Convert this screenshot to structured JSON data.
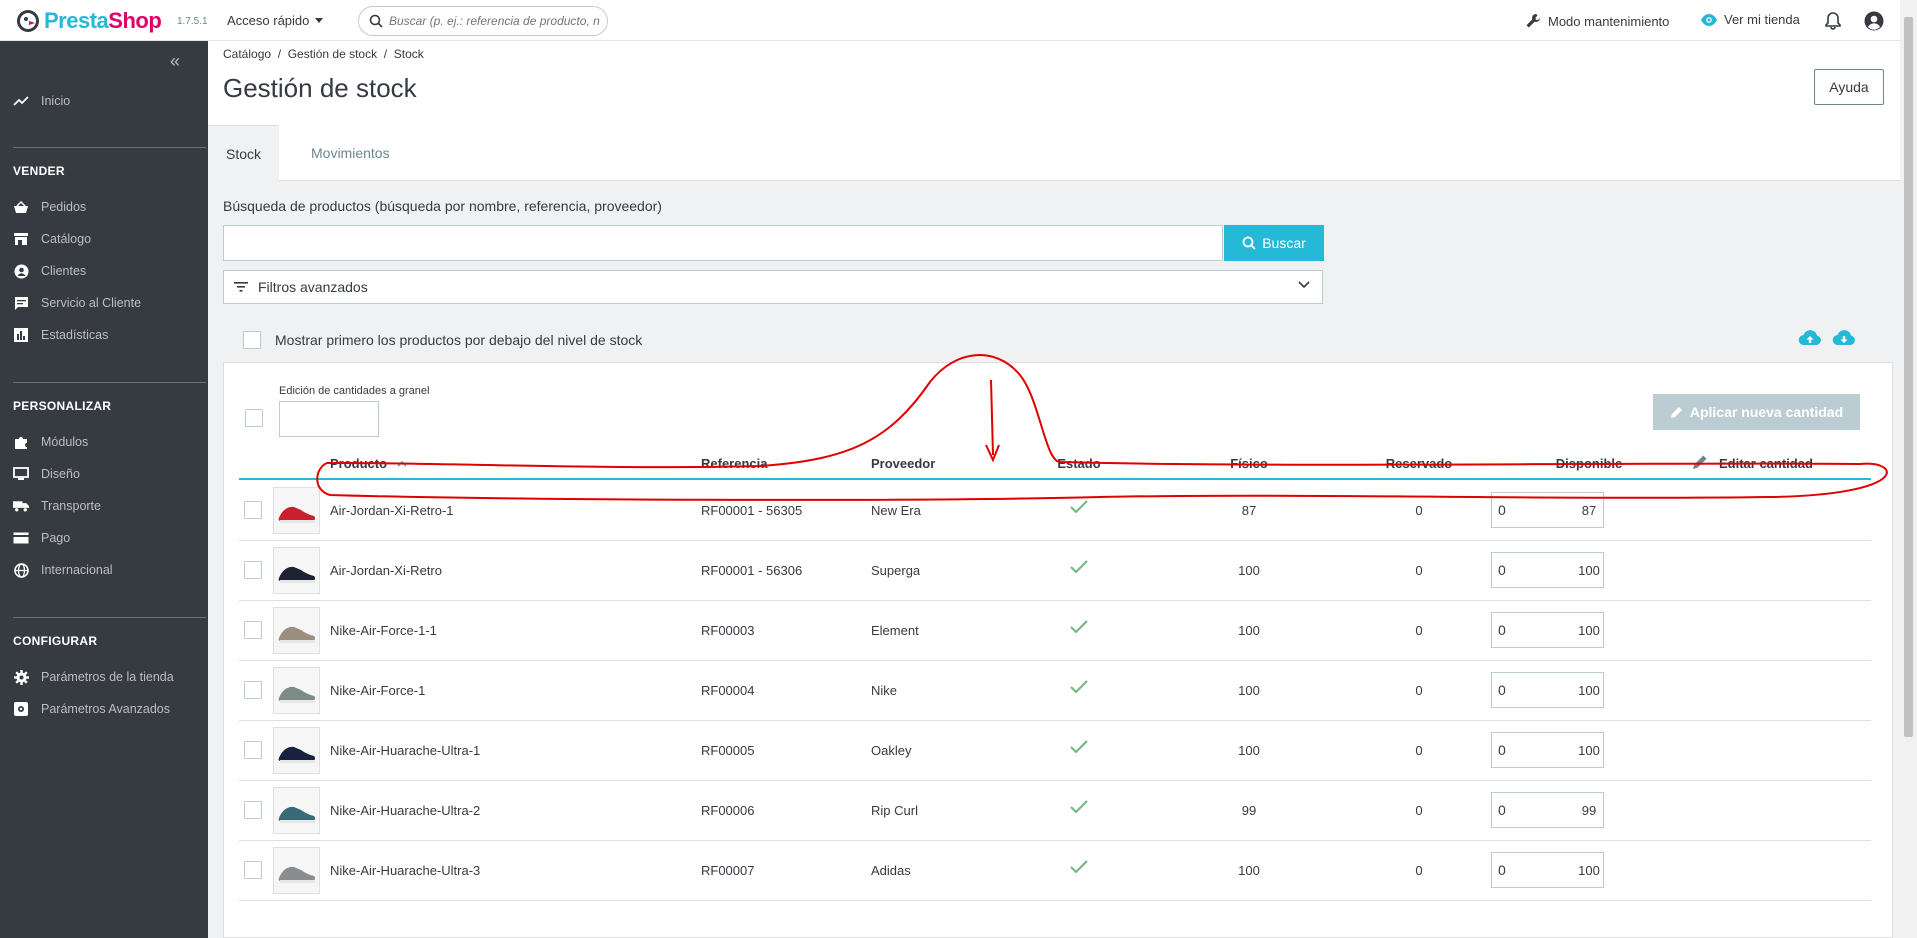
{
  "header": {
    "logo_text_a": "Presta",
    "logo_text_b": "Shop",
    "version": "1.7.5.1",
    "quick_access": "Acceso rápido",
    "search_placeholder": "Buscar (p. ej.: referencia de producto, n",
    "maintenance": "Modo mantenimiento",
    "view_store": "Ver mi tienda"
  },
  "sidebar": {
    "home": "Inicio",
    "sections": [
      {
        "title": "VENDER",
        "items": [
          "Pedidos",
          "Catálogo",
          "Clientes",
          "Servicio al Cliente",
          "Estadísticas"
        ]
      },
      {
        "title": "PERSONALIZAR",
        "items": [
          "Módulos",
          "Diseño",
          "Transporte",
          "Pago",
          "Internacional"
        ]
      },
      {
        "title": "CONFIGURAR",
        "items": [
          "Parámetros de la tienda",
          "Parámetros Avanzados"
        ]
      }
    ]
  },
  "page": {
    "breadcrumb": "Catálogo  /  Gestión de stock  /  Stock",
    "title": "Gestión de stock",
    "help": "Ayuda",
    "tabs": [
      "Stock",
      "Movimientos"
    ],
    "search_label": "Búsqueda de productos (búsqueda por nombre, referencia, proveedor)",
    "search_button": "Buscar",
    "advanced_filters": "Filtros avanzados",
    "low_stock_toggle": "Mostrar primero los productos por debajo del nivel de stock",
    "bulk_label": "Edición de cantidades a granel",
    "apply_button": "Aplicar nueva cantidad"
  },
  "table": {
    "columns": [
      "Producto",
      "Referencia",
      "Proveedor",
      "Estado",
      "Físico",
      "Reservado",
      "Disponible",
      "Editar cantidad"
    ],
    "rows": [
      {
        "name": "Air-Jordan-Xi-Retro-1",
        "ref": "RF00001 - 56305",
        "supplier": "New Era",
        "physical": "87",
        "reserved": "0",
        "available": "87",
        "edit": "0",
        "shoe_color": "#c8202c"
      },
      {
        "name": "Air-Jordan-Xi-Retro",
        "ref": "RF00001 - 56306",
        "supplier": "Superga",
        "physical": "100",
        "reserved": "0",
        "available": "100",
        "edit": "0",
        "shoe_color": "#1f2230"
      },
      {
        "name": "Nike-Air-Force-1-1",
        "ref": "RF00003",
        "supplier": "Element",
        "physical": "100",
        "reserved": "0",
        "available": "100",
        "edit": "0",
        "shoe_color": "#9a8f7d"
      },
      {
        "name": "Nike-Air-Force-1",
        "ref": "RF00004",
        "supplier": "Nike",
        "physical": "100",
        "reserved": "0",
        "available": "100",
        "edit": "0",
        "shoe_color": "#7d8a86"
      },
      {
        "name": "Nike-Air-Huarache-Ultra-1",
        "ref": "RF00005",
        "supplier": "Oakley",
        "physical": "100",
        "reserved": "0",
        "available": "100",
        "edit": "0",
        "shoe_color": "#1a2040"
      },
      {
        "name": "Nike-Air-Huarache-Ultra-2",
        "ref": "RF00006",
        "supplier": "Rip Curl",
        "physical": "99",
        "reserved": "0",
        "available": "99",
        "edit": "0",
        "shoe_color": "#3a6a7a"
      },
      {
        "name": "Nike-Air-Huarache-Ultra-3",
        "ref": "RF00007",
        "supplier": "Adidas",
        "physical": "100",
        "reserved": "0",
        "available": "100",
        "edit": "0",
        "shoe_color": "#8a8d90"
      }
    ]
  },
  "colors": {
    "accent": "#25b9d7",
    "brand_pink": "#df0067",
    "sidebar": "#363a41",
    "success": "#70b580",
    "annotation": "#e00000"
  }
}
